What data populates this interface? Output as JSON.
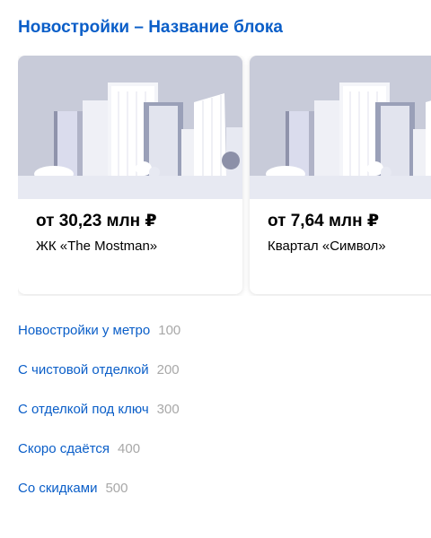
{
  "block": {
    "title": "Новостройки – Название блока"
  },
  "cards": [
    {
      "price": "от 30,23 млн ₽",
      "name": "ЖК «The Mostman»"
    },
    {
      "price": "от 7,64 млн ₽",
      "name": "Квартал «Символ»"
    }
  ],
  "links": [
    {
      "label": "Новостройки у метро",
      "count": "100"
    },
    {
      "label": "С чистовой отделкой",
      "count": "200"
    },
    {
      "label": "С отделкой под ключ",
      "count": "300"
    },
    {
      "label": "Скоро сдаётся",
      "count": "400"
    },
    {
      "label": "Со скидками",
      "count": "500"
    }
  ],
  "colors": {
    "link": "#0a5ec8",
    "count": "#a8a8a8",
    "illustration_sky": "#c8cbd9",
    "illustration_ground": "#e7e9f2",
    "illustration_dot": "#8c90a8"
  },
  "icons": {
    "card_image": "city-skyline-illustration"
  }
}
